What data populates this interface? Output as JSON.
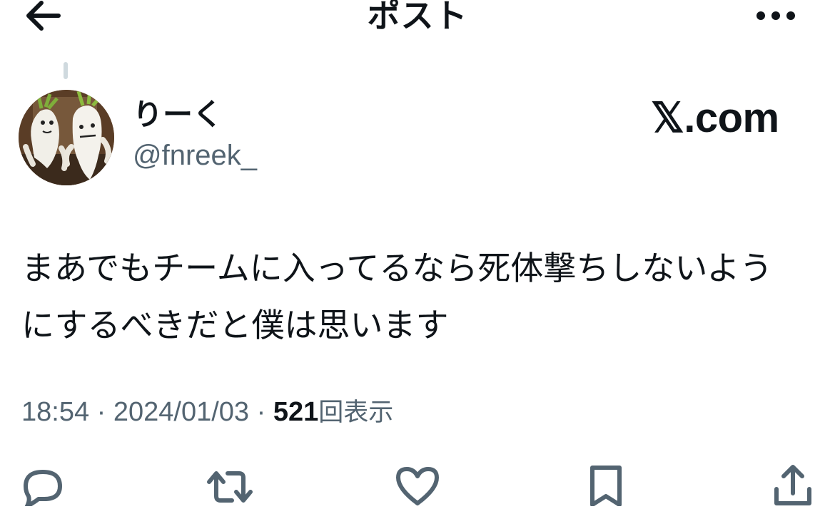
{
  "header": {
    "title": "ポスト"
  },
  "author": {
    "display_name": "りーく",
    "handle": "@fnreek_"
  },
  "watermark": "𝕏.com",
  "post": {
    "text_line1": "まあでもチームに入ってるなら死体撃ちしないよう",
    "text_line2": "にするべきだと僕は思います"
  },
  "meta": {
    "time": "18:54",
    "separator": " · ",
    "date": "2024/01/03",
    "views_count": "521",
    "views_label": "回表示"
  },
  "icons": {
    "back": "arrow-left-icon",
    "more": "more-horizontal-icon",
    "reply": "reply-icon",
    "repost": "repost-icon",
    "like": "heart-icon",
    "bookmark": "bookmark-icon",
    "share": "share-icon"
  },
  "colors": {
    "text": "#0f1419",
    "secondary": "#536471",
    "thread_line": "#cfd9de"
  }
}
